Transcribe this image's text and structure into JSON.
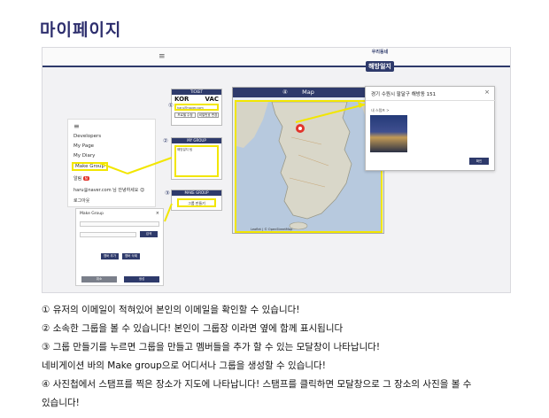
{
  "page_title": "마이페이지",
  "screenshot": {
    "brand_sub": "우리동네",
    "brand_main": "해방일지",
    "hamburger": "≡",
    "nav": {
      "items": [
        "Developers",
        "My Page",
        "My Diary",
        "Make Group"
      ],
      "alarm": "알림",
      "alarm_badge": "N",
      "email": "haru@naver.com 님 안녕하세요 😊",
      "logout": "로그아웃"
    },
    "ticket": {
      "header": "TICKET",
      "code_from": "KOR",
      "code_to": "VAC",
      "email": "haru@naver.com",
      "btn_left": "프로필 수정",
      "btn_right": "비밀번호 변경"
    },
    "my_group": {
      "header": "MY GROUP",
      "content": "해방일지 팀"
    },
    "make_group": {
      "header": "MAKE GROUP",
      "button": "그룹 만들기"
    },
    "group_modal": {
      "title": "Make Group",
      "close": "×",
      "search_btn": "검색",
      "add_btn": "멤버 추가",
      "delete_btn": "멤버 삭제",
      "cancel": "취소",
      "create": "생성"
    },
    "map": {
      "header": "Map",
      "footer": "Leaflet | © OpenStreetMap"
    },
    "place_modal": {
      "title": "경기 수원시 팔달구 해방동 151",
      "close": "×",
      "photos_label": "내 스탬프 >",
      "button": "확인"
    },
    "markers": [
      "①",
      "②",
      "③",
      "④"
    ]
  },
  "descriptions": [
    "① 유저의 이메일이 적혀있어 본인의 이메일을 확인할 수 있습니다!",
    "② 소속한 그룹을 볼 수 있습니다! 본인이 그룹장 이라면 옆에 함께 표시됩니다",
    "③ 그룹 만들기를 누르면 그룹을 만들고 멤버들을 추가 할 수 있는 모달창이 나타납니다!",
    "네비게이션 바의 Make group으로 어디서나 그룹을 생성할 수 있습니다!",
    "④ 사진첩에서 스탬프를 찍은 장소가 지도에 나타납니다! 스탬프를 클릭하면 모달창으로 그 장소의 사진을 볼 수",
    "있습니다!"
  ],
  "colors": {
    "title": "#2e2f6e",
    "navy": "#2e3a6b",
    "highlight": "#f2e600",
    "stamp": "#e2342b"
  }
}
